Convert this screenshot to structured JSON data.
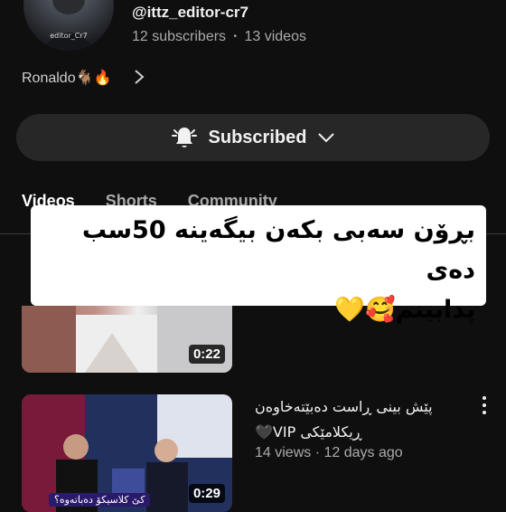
{
  "channel": {
    "avatar_caption": "editor_Cr7",
    "handle": "@ittz_editor-cr7",
    "subscribers": "12 subscribers",
    "separator": "•",
    "videos": "13 videos",
    "description": "Ronaldo🐐🔥"
  },
  "subscribe_button": {
    "label": "Subscribed",
    "icon": "bell-icon"
  },
  "tabs": [
    {
      "label": "Videos",
      "active": true
    },
    {
      "label": "Shorts",
      "active": false
    },
    {
      "label": "Community",
      "active": false
    }
  ],
  "overlay": {
    "line1": "بڕۆن سەبی بکەن بیگەینە 50سب دەی",
    "line2": "پدابینم🥰💛"
  },
  "videos": [
    {
      "duration": "0:22"
    },
    {
      "duration": "0:29",
      "title_line1": "پێش بینی ڕاست دەبێتەخاوەن",
      "title_line2": "ڕیکلامێکی VIP🖤",
      "views": "14 views",
      "separator": "·",
      "age": "12 days ago",
      "thumb_caption": "کێ کلاسیکۆ دەباتەوە؟"
    }
  ],
  "colors": {
    "background": "#0f0f0f",
    "pill": "#272727",
    "secondary_text": "#aaaaaa"
  }
}
